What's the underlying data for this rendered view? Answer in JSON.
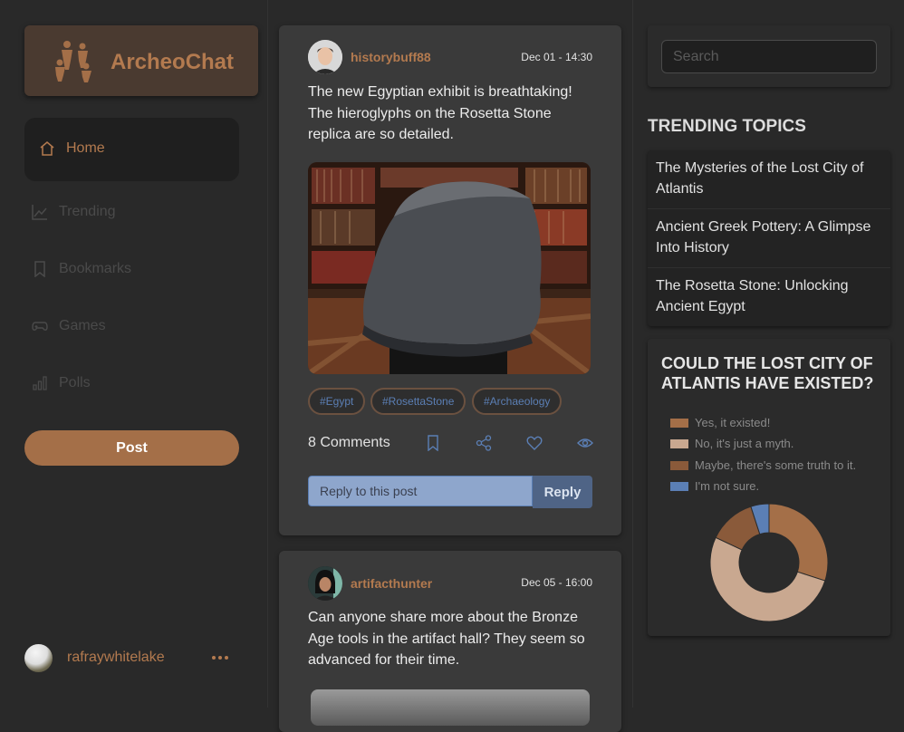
{
  "app": {
    "name": "ArcheoChat"
  },
  "nav": {
    "items": [
      {
        "label": "Home",
        "icon": "home-icon"
      },
      {
        "label": "Trending",
        "icon": "trending-icon"
      },
      {
        "label": "Bookmarks",
        "icon": "bookmark-icon"
      },
      {
        "label": "Games",
        "icon": "gamepad-icon"
      },
      {
        "label": "Polls",
        "icon": "bar-chart-icon"
      }
    ],
    "post_button": "Post"
  },
  "current_user": {
    "name": "rafraywhitelake"
  },
  "posts": [
    {
      "user": "historybuff88",
      "time": "Dec 01 - 14:30",
      "text": "The new Egyptian exhibit is breathtaking! The hieroglyphs on the Rosetta Stone replica are so detailed.",
      "tags": [
        "#Egypt",
        "#RosettaStone",
        "#Archaeology"
      ],
      "comments": "8 Comments",
      "reply_placeholder": "Reply to this post",
      "reply_button": "Reply"
    },
    {
      "user": "artifacthunter",
      "time": "Dec 05 - 16:00",
      "text": "Can anyone share more about the Bronze Age tools in the artifact hall? They seem so advanced for their time."
    }
  ],
  "search": {
    "placeholder": "Search"
  },
  "trending": {
    "title": "TRENDING TOPICS",
    "topics": [
      "The Mysteries of the Lost City of Atlantis",
      "Ancient Greek Pottery: A Glimpse Into History",
      "The Rosetta Stone: Unlocking Ancient Egypt"
    ]
  },
  "poll": {
    "question": "COULD THE LOST CITY OF ATLANTIS HAVE EXISTED?",
    "options": [
      {
        "label": "Yes, it existed!",
        "color": "#a46f48"
      },
      {
        "label": "No, it's just a myth.",
        "color": "#c9a890"
      },
      {
        "label": "Maybe, there's some truth to it.",
        "color": "#8a5a3a"
      },
      {
        "label": "I'm not sure.",
        "color": "#5b7fb5"
      }
    ]
  },
  "chart_data": {
    "type": "pie",
    "categories": [
      "Yes, it existed!",
      "No, it's just a myth.",
      "Maybe, there's some truth to it.",
      "I'm not sure."
    ],
    "values": [
      30,
      52,
      13,
      5
    ]
  },
  "colors": {
    "accent": "#b37a4f",
    "link": "#5b7fb5"
  }
}
